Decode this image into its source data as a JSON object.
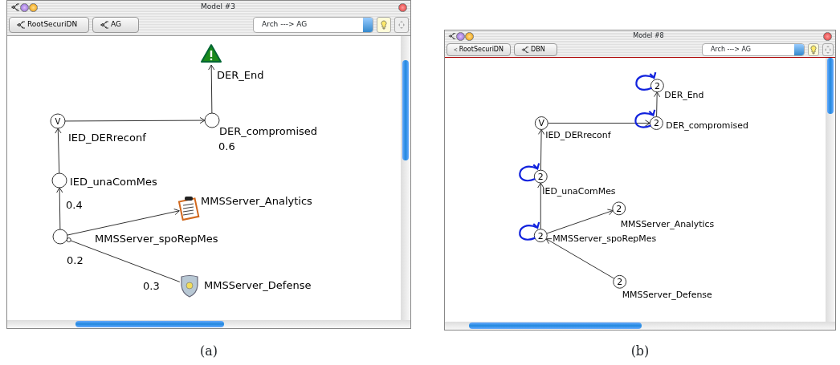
{
  "figures": [
    {
      "caption": "(a)",
      "window": {
        "title": "Model #3",
        "tabs": [
          {
            "label": "RootSecuriDN"
          },
          {
            "label": "AG"
          }
        ],
        "dropdown": {
          "value": "Arch ---> AG"
        }
      },
      "graph": {
        "nodes": [
          {
            "label": "DER_End",
            "kind": "goal-icon",
            "self_loop": false
          },
          {
            "label": "IED_DERreconf",
            "kind": "circle",
            "mark": "V",
            "self_loop": false
          },
          {
            "label": "DER_compromised",
            "kind": "circle",
            "value": "0.6",
            "self_loop": false
          },
          {
            "label": "IED_unaComMes",
            "kind": "circle",
            "value": "0.4",
            "self_loop": false
          },
          {
            "label": "MMSServer_Analytics",
            "kind": "report-icon",
            "self_loop": false
          },
          {
            "label": "MMSServer_spoRepMes",
            "kind": "circle",
            "value": "0.2",
            "self_loop": false
          },
          {
            "label": "MMSServer_Defense",
            "kind": "shield-icon",
            "value": "0.3",
            "self_loop": false
          }
        ],
        "edges": [
          {
            "kind": "arrow"
          },
          {
            "kind": "arrow"
          },
          {
            "kind": "arrow"
          },
          {
            "kind": "arrow"
          },
          {
            "kind": "arrow"
          },
          {
            "kind": "defense"
          }
        ]
      }
    },
    {
      "caption": "(b)",
      "window": {
        "title": "Model #8",
        "tabs": [
          {
            "label": "RootSecuriDN"
          },
          {
            "label": "DBN"
          }
        ],
        "dropdown": {
          "value": "Arch ---> AG"
        }
      },
      "graph": {
        "nodes": [
          {
            "label": "DER_End",
            "kind": "circle",
            "mark": "2",
            "self_loop": true
          },
          {
            "label": "IED_DERreconf",
            "kind": "circle",
            "mark": "V",
            "self_loop": false
          },
          {
            "label": "DER_compromised",
            "kind": "circle",
            "mark": "2",
            "self_loop": true
          },
          {
            "label": "IED_unaComMes",
            "kind": "circle",
            "mark": "2",
            "self_loop": true
          },
          {
            "label": "MMSServer_Analytics",
            "kind": "circle",
            "mark": "2",
            "self_loop": false
          },
          {
            "label": "MMSServer_spoRepMes",
            "kind": "circle",
            "mark": "2",
            "self_loop": true
          },
          {
            "label": "MMSServer_Defense",
            "kind": "circle",
            "mark": "2",
            "self_loop": false
          }
        ],
        "edges": [
          {
            "kind": "arrow"
          },
          {
            "kind": "arrow"
          },
          {
            "kind": "arrow"
          },
          {
            "kind": "arrow"
          },
          {
            "kind": "arrow"
          },
          {
            "kind": "arrow"
          }
        ]
      }
    }
  ]
}
